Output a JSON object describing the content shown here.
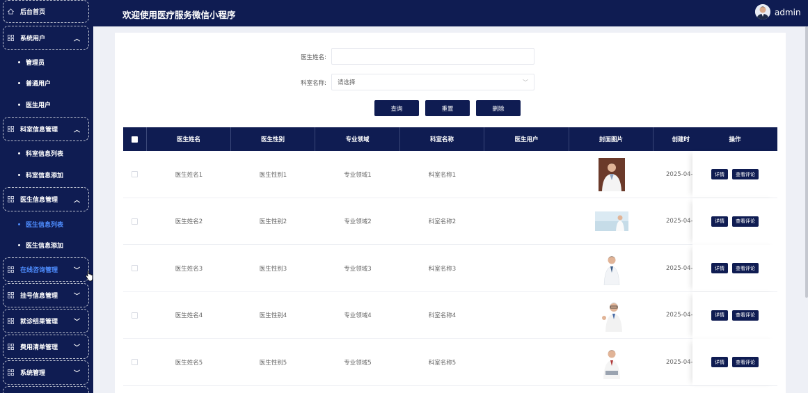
{
  "header": {
    "title": "欢迎使用医疗服务微信小程序",
    "username": "admin"
  },
  "sidebar": {
    "home": "后台首页",
    "groups": [
      {
        "label": "系统用户",
        "expanded": true,
        "children": [
          "管理员",
          "普通用户",
          "医生用户"
        ]
      },
      {
        "label": "科室信息管理",
        "expanded": true,
        "children": [
          "科室信息列表",
          "科室信息添加"
        ]
      },
      {
        "label": "医生信息管理",
        "expanded": true,
        "children": [
          "医生信息列表",
          "医生信息添加"
        ]
      },
      {
        "label": "在线咨询管理",
        "expanded": false,
        "children": []
      },
      {
        "label": "挂号信息管理",
        "expanded": false,
        "children": []
      },
      {
        "label": "就诊结果管理",
        "expanded": false,
        "children": []
      },
      {
        "label": "费用清单管理",
        "expanded": false,
        "children": []
      },
      {
        "label": "系统管理",
        "expanded": false,
        "children": []
      }
    ],
    "active_item": "医生信息列表",
    "hover_group": "在线咨询管理"
  },
  "search": {
    "name_label": "医生姓名:",
    "name_value": "",
    "dept_label": "科室名称:",
    "dept_placeholder": "请选择",
    "query_btn": "查询",
    "reset_btn": "重置",
    "delete_btn": "删除"
  },
  "table": {
    "columns": [
      "医生姓名",
      "医生性别",
      "专业领域",
      "科室名称",
      "医生用户",
      "封面图片",
      "创建时",
      "操作"
    ],
    "rows": [
      {
        "name": "医生姓名1",
        "gender": "医生性别1",
        "field": "专业领域1",
        "dept": "科室名称1",
        "user": "",
        "created": "2025-04-",
        "detail": "详情",
        "review": "查看评论"
      },
      {
        "name": "医生姓名2",
        "gender": "医生性别2",
        "field": "专业领域2",
        "dept": "科室名称2",
        "user": "",
        "created": "2025-04-",
        "detail": "详情",
        "review": "查看评论"
      },
      {
        "name": "医生姓名3",
        "gender": "医生性别3",
        "field": "专业领域3",
        "dept": "科室名称3",
        "user": "",
        "created": "2025-04-",
        "detail": "详情",
        "review": "查看评论"
      },
      {
        "name": "医生姓名4",
        "gender": "医生性别4",
        "field": "专业领域4",
        "dept": "科室名称4",
        "user": "",
        "created": "2025-04-",
        "detail": "详情",
        "review": "查看评论"
      },
      {
        "name": "医生姓名5",
        "gender": "医生性别5",
        "field": "专业领域5",
        "dept": "科室名称5",
        "user": "",
        "created": "2025-04-",
        "detail": "详情",
        "review": "查看评论"
      }
    ]
  },
  "colors": {
    "navy": "#0f1c52",
    "active_blue": "#4e8dff"
  }
}
